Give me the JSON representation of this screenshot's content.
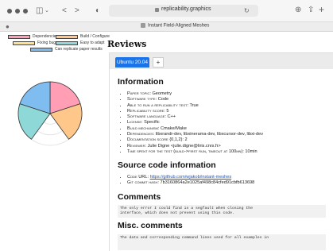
{
  "browser": {
    "url": "replicability.graphics",
    "tab_title": "Instant Field-Aligned Meshes",
    "colors": {
      "toolbar": "#f6f6f6",
      "accent": "#1a73e8"
    }
  },
  "chart_data": {
    "type": "pie",
    "legend": [
      "Dependencies",
      "Build / Configure",
      "Fixing bugs",
      "Easy to adapt",
      "Can replicate paper results"
    ],
    "colors": [
      "#ff9eb5",
      "#ffc78a",
      "#ffe08a",
      "#8fd8d8",
      "#7fbdf0"
    ],
    "values": [
      1,
      1,
      0,
      1,
      1
    ],
    "max": 5
  },
  "reviews": {
    "heading": "Reviews",
    "tab_label": "Ubuntu 20.04",
    "add_label": "+",
    "information_heading": "Information",
    "items": [
      {
        "key": "Paper topic:",
        "value": "Geometry"
      },
      {
        "key": "Software type:",
        "value": "Code"
      },
      {
        "key": "Able to run a replicability test:",
        "value": "True"
      },
      {
        "key": "Replicability score:",
        "value": "5"
      },
      {
        "key": "Software language:",
        "value": "C++"
      },
      {
        "key": "License:",
        "value": "Specific"
      },
      {
        "key": "Build mechanism:",
        "value": "Cmake/Make"
      },
      {
        "key": "Dependencies:",
        "value": "libxrandr-dev, libxinerama-dev, libxcursor-dev, libxi-dev"
      },
      {
        "key": "Documentation score {0,1,2}:",
        "value": "2"
      },
      {
        "key": "Reviewer:",
        "value": "Julie Digne <julie.digne@liris.cnrs.fr>"
      },
      {
        "key": "Time spent for the test (build->first run, timeout at 100mn):",
        "value": "10min"
      }
    ],
    "source_heading": "Source code information",
    "code_url_key": "Code URL:",
    "code_url": "https://github.com/wjakob/instant-meshes",
    "git_key": "Git commit hash:",
    "git_hash": "7b3160864a2e1025af498c84cfed91cbfb613698",
    "comments_heading": "Comments",
    "comments_text": "The only error I could find is a segfault when closing the\ninterface, which does not prevent using this code.",
    "misc_heading": "Misc. comments",
    "misc_text": "The data and corresponding command lines used for all examples in"
  }
}
